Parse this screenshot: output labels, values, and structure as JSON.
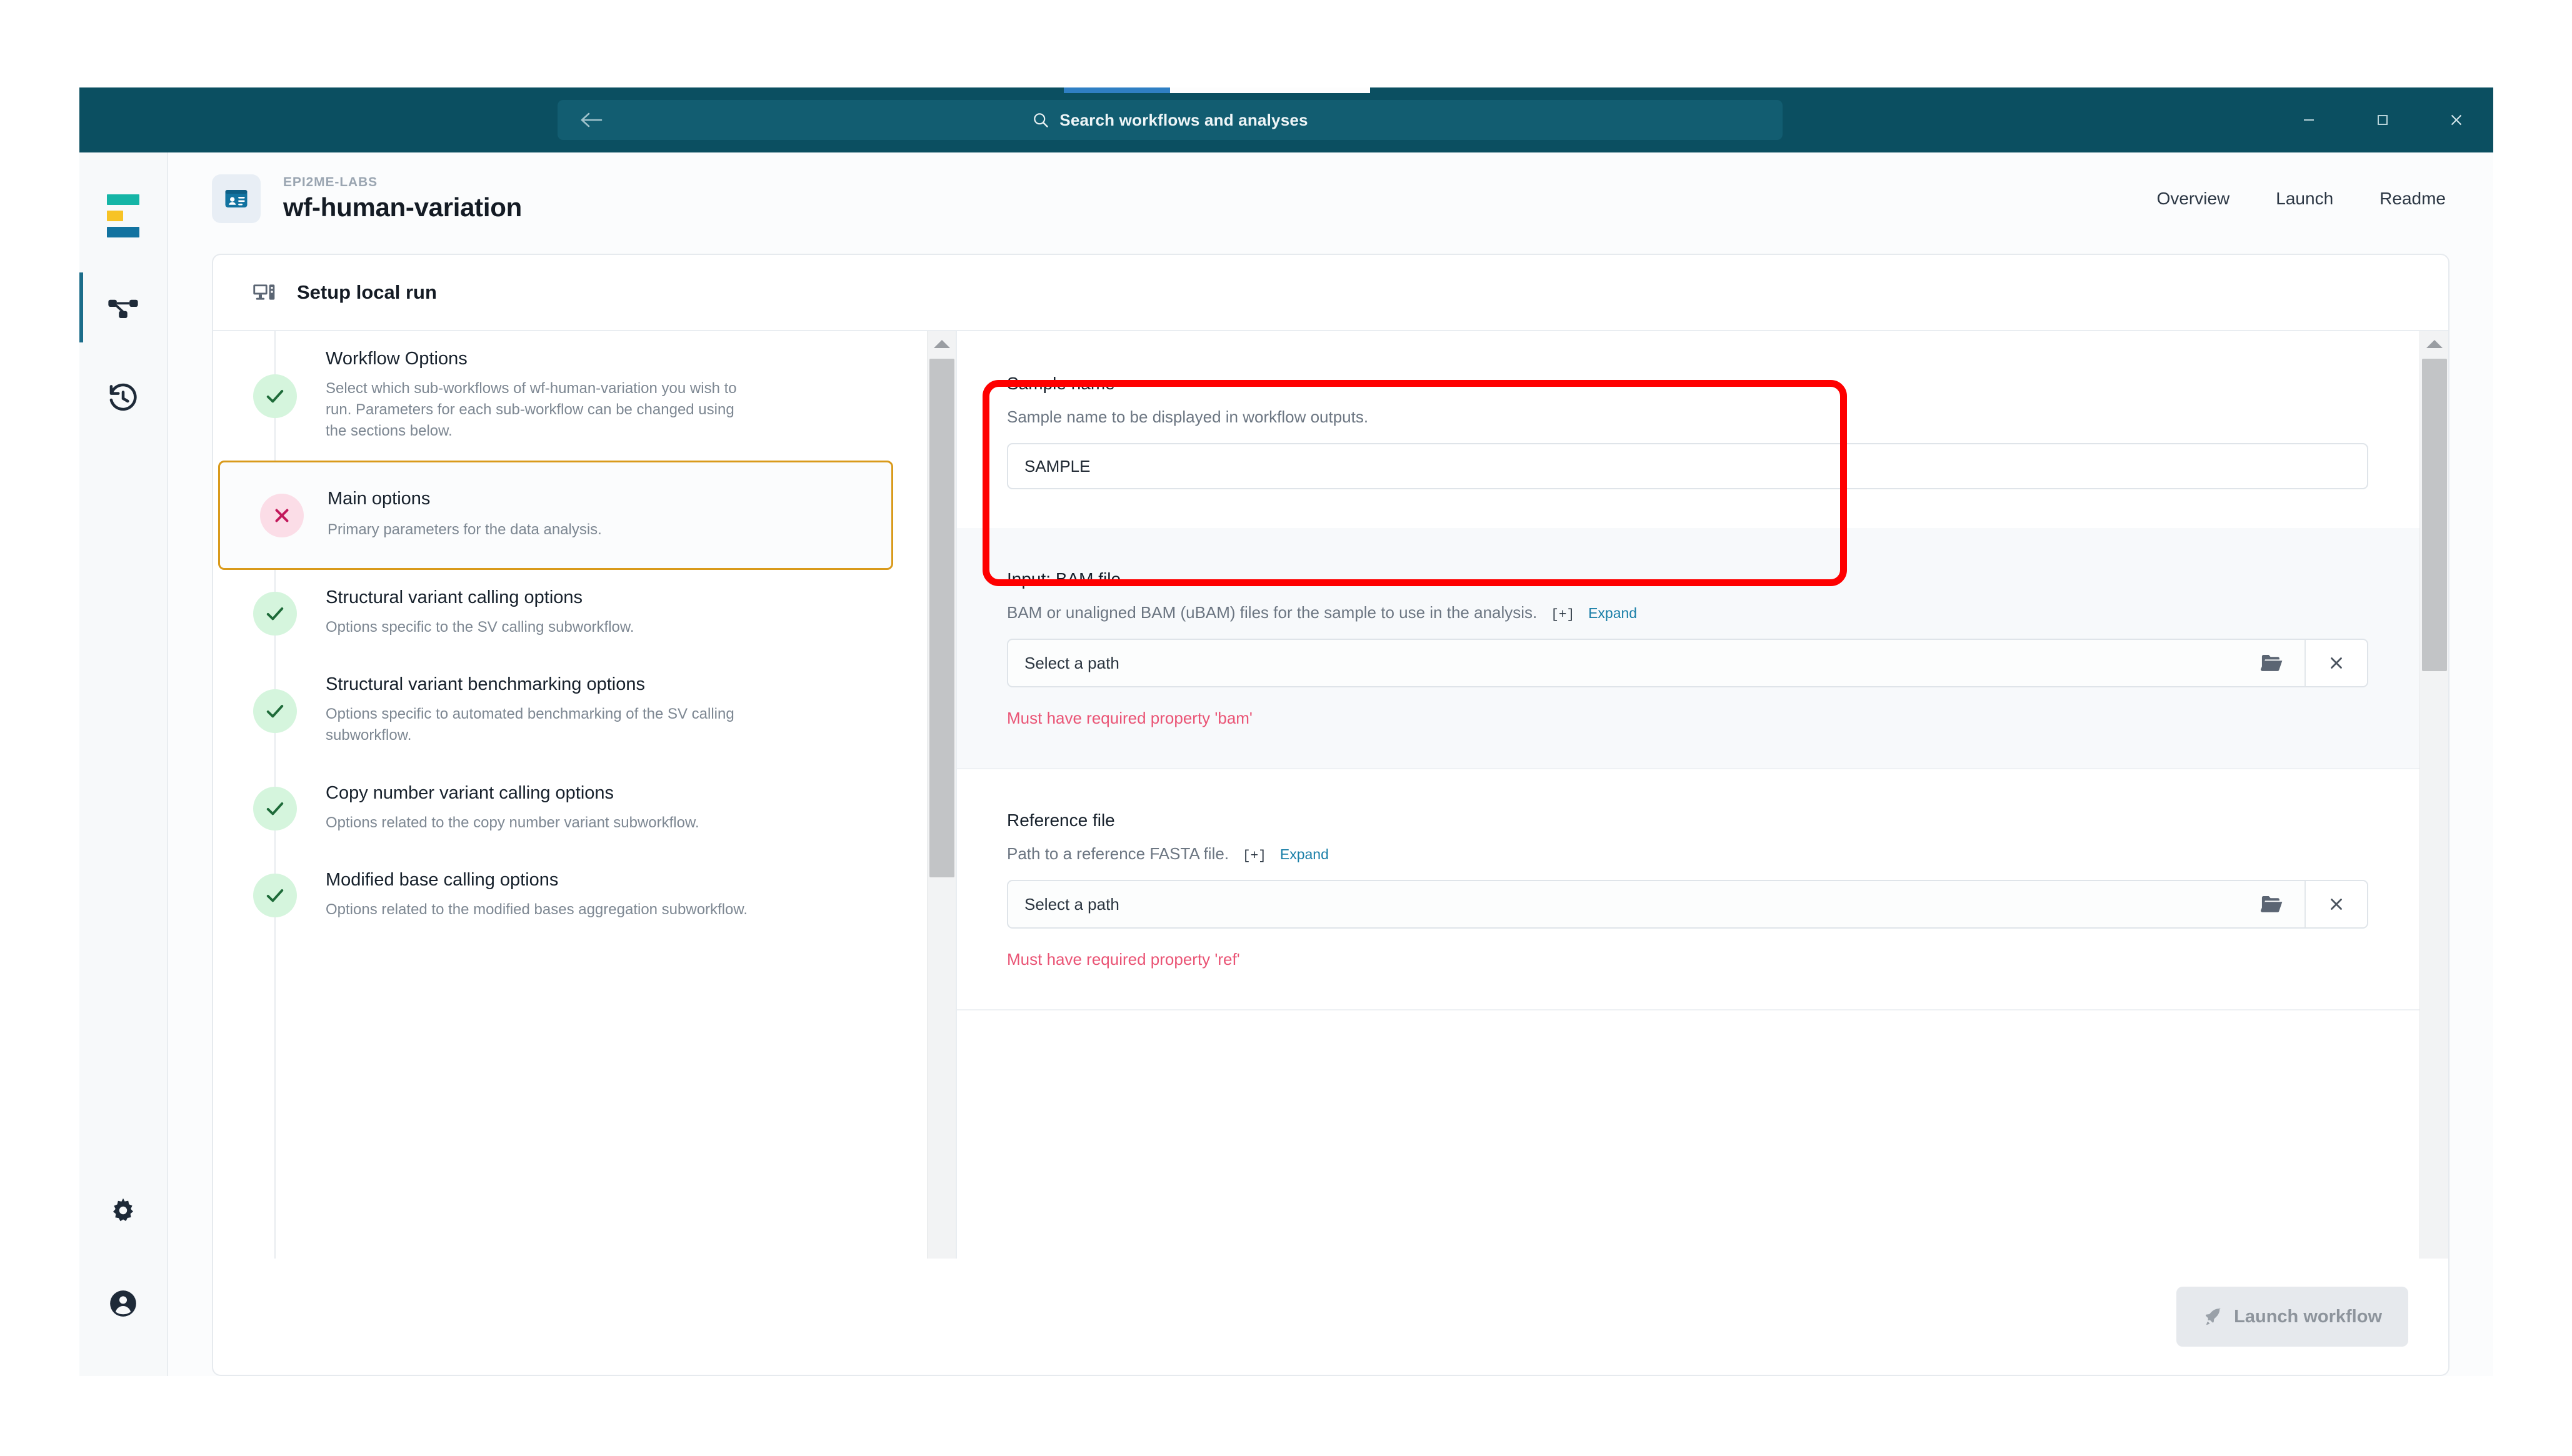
{
  "titlebar": {
    "search_placeholder": "Search workflows and analyses",
    "search_icon": "search-icon",
    "back_icon": "back-arrow-icon",
    "minimize_label": "–",
    "maximize_label": "□",
    "close_label": "✕"
  },
  "rail": {
    "logo_name": "epi2me-logo",
    "items": [
      {
        "icon": "epi2me-logo-icon",
        "name": "logo"
      },
      {
        "icon": "workflows-icon",
        "name": "workflows",
        "active": true
      },
      {
        "icon": "history-icon",
        "name": "history"
      }
    ],
    "bottom_items": [
      {
        "icon": "gear-icon",
        "name": "settings"
      },
      {
        "icon": "account-icon",
        "name": "account"
      }
    ]
  },
  "header": {
    "org": "EPI2ME-LABS",
    "workflow_name": "wf-human-variation",
    "badge_icon": "workflow-card-icon",
    "nav": [
      {
        "label": "Overview"
      },
      {
        "label": "Launch"
      },
      {
        "label": "Readme"
      }
    ]
  },
  "card": {
    "title": "Setup local run",
    "title_icon": "desktop-icon"
  },
  "steps": [
    {
      "title": "Workflow Options",
      "desc": "Select which sub-workflows of wf-human-variation you wish to run. Parameters for each sub-workflow can be changed using the sections below.",
      "status": "ok",
      "status_glyph": "✓",
      "selected": false
    },
    {
      "title": "Main options",
      "desc": "Primary parameters for the data analysis.",
      "status": "err",
      "status_glyph": "✕",
      "selected": true
    },
    {
      "title": "Structural variant calling options",
      "desc": "Options specific to the SV calling subworkflow.",
      "status": "ok",
      "status_glyph": "✓",
      "selected": false
    },
    {
      "title": "Structural variant benchmarking options",
      "desc": "Options specific to automated benchmarking of the SV calling subworkflow.",
      "status": "ok",
      "status_glyph": "✓",
      "selected": false
    },
    {
      "title": "Copy number variant calling options",
      "desc": "Options related to the copy number variant subworkflow.",
      "status": "ok",
      "status_glyph": "✓",
      "selected": false
    },
    {
      "title": "Modified base calling options",
      "desc": "Options related to the modified bases aggregation subworkflow.",
      "status": "ok",
      "status_glyph": "✓",
      "selected": false
    }
  ],
  "form": {
    "sample_name": {
      "label": "Sample name",
      "help": "Sample name to be displayed in workflow outputs.",
      "value": "SAMPLE"
    },
    "bam": {
      "label": "Input: BAM file",
      "help": "BAM or unaligned BAM (uBAM) files for the sample to use in the analysis.",
      "expand_plus": "[+]",
      "expand_label": "Expand",
      "path_placeholder": "Select a path",
      "browse_icon": "folder-open-icon",
      "clear_icon": "close-icon",
      "error": "Must have required property 'bam'"
    },
    "ref": {
      "label": "Reference file",
      "help": "Path to a reference FASTA file.",
      "expand_plus": "[+]",
      "expand_label": "Expand",
      "path_placeholder": "Select a path",
      "browse_icon": "folder-open-icon",
      "clear_icon": "close-icon",
      "error": "Must have required property 'ref'"
    }
  },
  "footer": {
    "launch_label": "Launch workflow",
    "launch_icon": "rocket-icon",
    "launch_disabled": true
  },
  "annotation": {
    "type": "highlight-rectangle",
    "color": "#fe0000",
    "target": "sample-name-field"
  },
  "colors": {
    "titlebar": "#0b4f61",
    "search_field": "#125d71",
    "accent_blue": "#1a7fa8",
    "selected_border": "#d99a1b",
    "error_text": "#ea5475",
    "status_ok_bg": "#d5f5dd",
    "status_err_bg": "#fbdde7",
    "annotation": "#fe0000"
  }
}
